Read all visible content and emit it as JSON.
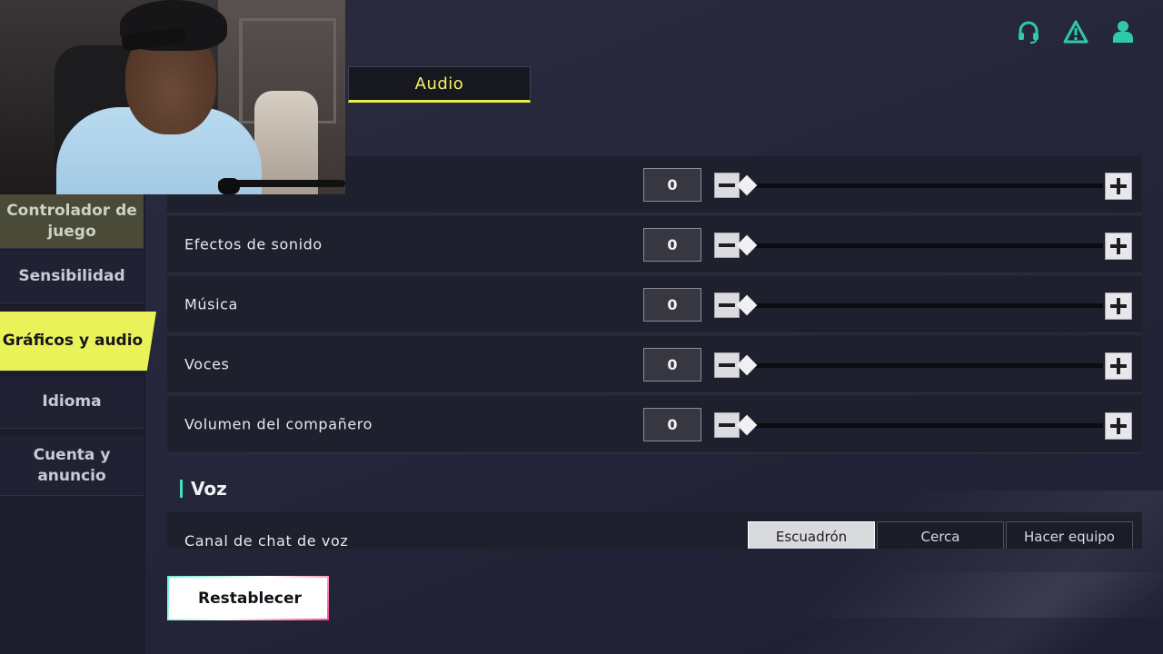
{
  "tab": {
    "label": "Audio"
  },
  "top_icons": [
    "headset-icon",
    "warning-icon",
    "profile-icon"
  ],
  "sidebar": {
    "items": [
      {
        "label": "Controlador de juego",
        "state": "partial"
      },
      {
        "label": "Sensibilidad"
      },
      {
        "label": "Gráficos y audio",
        "active": true
      },
      {
        "label": "Idioma"
      },
      {
        "label": "Cuenta y anuncio"
      }
    ]
  },
  "volume_rows": [
    {
      "label": "",
      "value": "0"
    },
    {
      "label": "Efectos de sonido",
      "value": "0"
    },
    {
      "label": "Música",
      "value": "0"
    },
    {
      "label": "Voces",
      "value": "0"
    },
    {
      "label": "Volumen del compañero",
      "value": "0"
    }
  ],
  "voice": {
    "section_title": "Voz",
    "channel_label": "Canal de chat de voz",
    "options": [
      "Escuadrón",
      "Cerca",
      "Hacer equipo"
    ],
    "selected": "Escuadrón"
  },
  "reset": {
    "label": "Restablecer"
  },
  "colors": {
    "accent": "#eaf25a",
    "teal": "#3fe0c5",
    "panel": "#1f202d"
  }
}
